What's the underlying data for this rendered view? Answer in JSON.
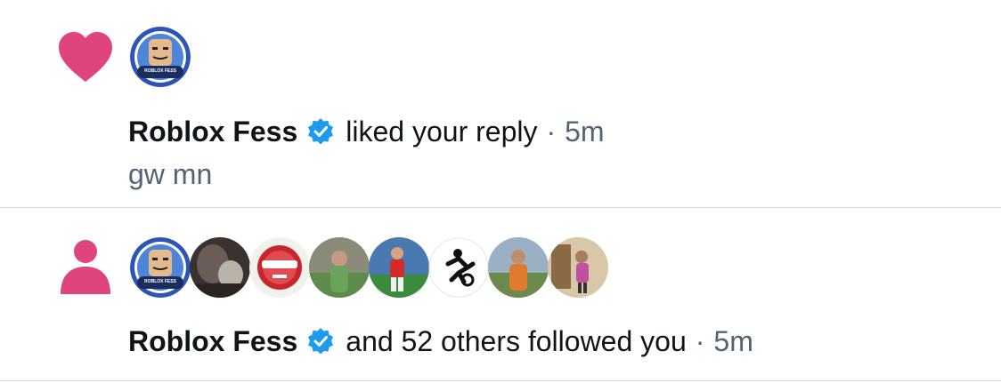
{
  "colors": {
    "accent_pink": "#e0447d",
    "verified_blue": "#1d9bf0",
    "secondary_text": "#536471",
    "divider": "#d6d9dc"
  },
  "notifications": [
    {
      "type_icon": "heart-icon",
      "actor": "Roblox Fess",
      "action": "liked your reply",
      "separator": "·",
      "time": "5m",
      "snippet": "gw mn",
      "avatar_labels": [
        "ROBLOX FESS"
      ]
    },
    {
      "type_icon": "person-icon",
      "actor": "Roblox Fess",
      "action": "and 52 others followed you",
      "separator": "·",
      "time": "5m",
      "avatar_labels": [
        "ROBLOX FESS",
        "",
        "",
        "",
        "",
        "",
        "",
        ""
      ]
    }
  ]
}
